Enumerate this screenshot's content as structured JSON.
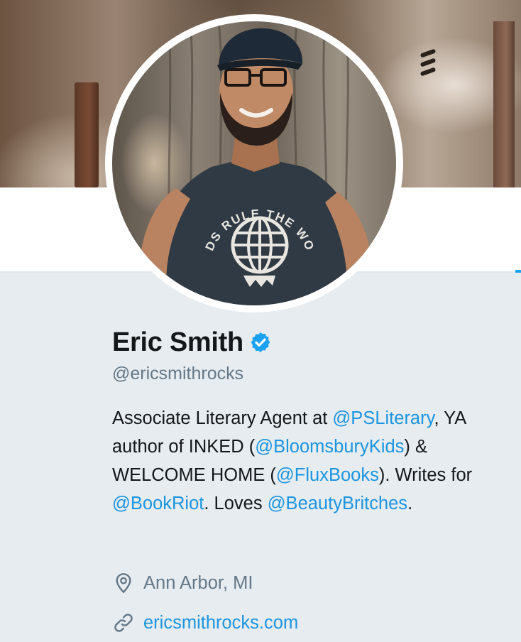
{
  "profile": {
    "name": "Eric Smith",
    "handle": "@ericsmithrocks",
    "verified_icon": "verified-badge-icon",
    "bio": {
      "t1": "Associate Literary Agent at ",
      "m1": "@PSLiterary",
      "t2": ", YA author of INKED (",
      "m2": "@BloomsburyKids",
      "t3": ") & WELCOME HOME (",
      "m3": "@FluxBooks",
      "t4": "). Writes for ",
      "m4": "@BookRiot",
      "t5": ". Loves ",
      "m5": "@BeautyBritches",
      "t6": "."
    },
    "location": "Ann Arbor, MI",
    "location_icon": "map-pin-icon",
    "website": "ericsmithrocks.com",
    "website_icon": "link-icon",
    "shirt_text": "NERDS RULE THE WORLD"
  },
  "colors": {
    "accent": "#1da1f2",
    "link": "#1b95e0",
    "text": "#14171a",
    "muted": "#657786",
    "background": "#e6ecf0"
  }
}
